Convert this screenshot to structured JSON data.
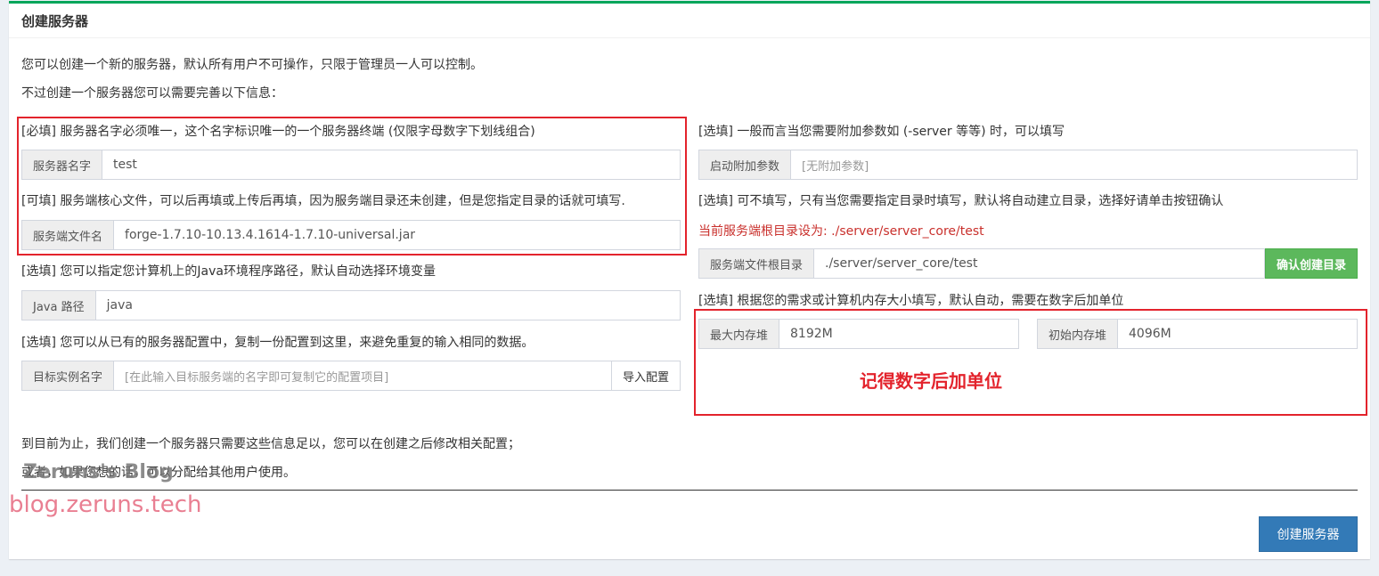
{
  "panel": {
    "title": "创建服务器",
    "intro_line1": "您可以创建一个新的服务器，默认所有用户不可操作，只限于管理员一人可以控制。",
    "intro_line2": "不过创建一个服务器您可以需要完善以下信息："
  },
  "left": {
    "server_name": {
      "hint": "[必填] 服务器名字必须唯一，这个名字标识唯一的一个服务器终端 (仅限字母数字下划线组合)",
      "label": "服务器名字",
      "value": "test"
    },
    "core_file": {
      "hint": "[可填] 服务端核心文件，可以后再填或上传后再填，因为服务端目录还未创建，但是您指定目录的话就可填写.",
      "label": "服务端文件名",
      "value": "forge-1.7.10-10.13.4.1614-1.7.10-universal.jar"
    },
    "java": {
      "hint": "[选填] 您可以指定您计算机上的Java环境程序路径，默认自动选择环境变量",
      "label": "Java 路径",
      "value": "java"
    },
    "copy_config": {
      "hint": "[选填] 您可以从已有的服务器配置中，复制一份配置到这里，来避免重复的输入相同的数据。",
      "label": "目标实例名字",
      "placeholder": "[在此输入目标服务端的名字即可复制它的配置项目]",
      "button": "导入配置"
    }
  },
  "right": {
    "launch_args": {
      "hint": "[选填] 一般而言当您需要附加参数如 (-server 等等) 时，可以填写",
      "label": "启动附加参数",
      "placeholder": "[无附加参数]"
    },
    "root_dir": {
      "hint": "[选填] 可不填写，只有当您需要指定目录时填写，默认将自动建立目录，选择好请单击按钮确认",
      "current": "当前服务端根目录设为: ./server/server_core/test",
      "label": "服务端文件根目录",
      "value": "./server/server_core/test",
      "button": "确认创建目录"
    },
    "memory": {
      "hint": "[选填] 根据您的需求或计算机内存大小填写，默认自动，需要在数字后加单位",
      "max_label": "最大内存堆",
      "max_value": "8192M",
      "init_label": "初始内存堆",
      "init_value": "4096M"
    },
    "annotation": "记得数字后加单位"
  },
  "footer": {
    "line1": "到目前为止，我们创建一个服务器只需要这些信息足以，您可以在创建之后修改相关配置；",
    "line2": "或者，如果您想的话，可以分配给其他用户使用。",
    "submit": "创建服务器"
  },
  "watermark": {
    "line1": "Zeruns's Blog",
    "line2": "blog.zeruns.tech"
  },
  "colors": {
    "accent_top": "#00a65a",
    "highlight_box": "#e3232c",
    "primary_button": "#337ab7",
    "confirm_button": "#5cb85c"
  }
}
